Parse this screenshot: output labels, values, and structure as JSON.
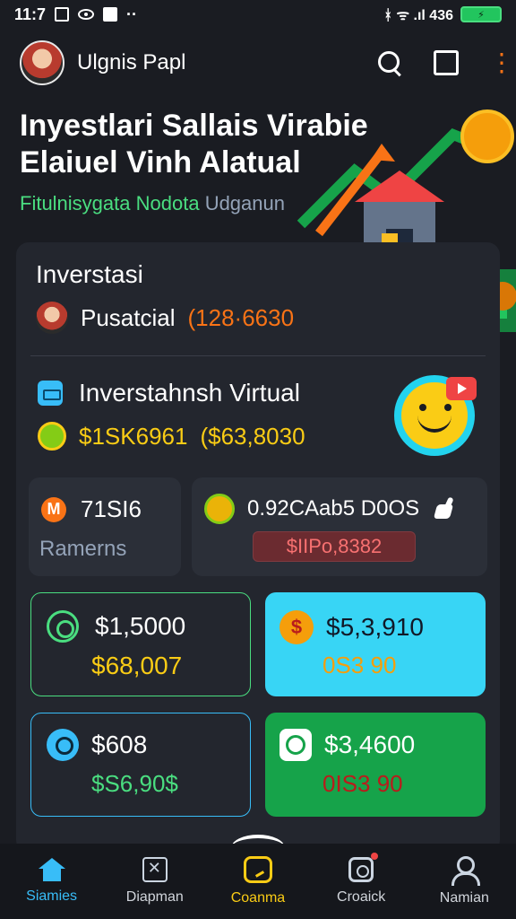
{
  "status_bar": {
    "time": "11:7",
    "right_text": "ᚼ ᯤ .ıl 436"
  },
  "header": {
    "user_name": "Ulgnis Papl"
  },
  "hero": {
    "title_line1": "Inyestlari Sallais Virabie",
    "title_line2": "Elaiuel Vinh Alatual",
    "subtitle_green": "Fitulnisygata Nodota",
    "subtitle_gray": "Udganun"
  },
  "invest": {
    "section_label": "Inverstasi",
    "row1_label": "Pusatcial",
    "row1_value": "(128·6630",
    "row2_title": "Inverstahnsh Virtual",
    "row2_value_a": "$1SK6961",
    "row2_value_b": "($63,8030"
  },
  "cards": {
    "left_top_value": "71SI6",
    "left_top_label": "Ramerns",
    "right_top_value": "0.92CAab5 D0OS",
    "right_top_pill": "$IIPo,8382",
    "c1_line1": "$1,5000",
    "c1_line2": "$68,007",
    "c2_line1": "$5,3,910",
    "c2_line2": "0S3 90",
    "c3_line1": "$608",
    "c3_line2": "$S6,90$",
    "c4_line1": "$3,4600",
    "c4_line2": "0IS3 90"
  },
  "bottom_nav": {
    "item1": "Siamies",
    "item2": "Diapman",
    "item3": "Coanma",
    "item4": "Croaick",
    "item5": "Namian"
  }
}
